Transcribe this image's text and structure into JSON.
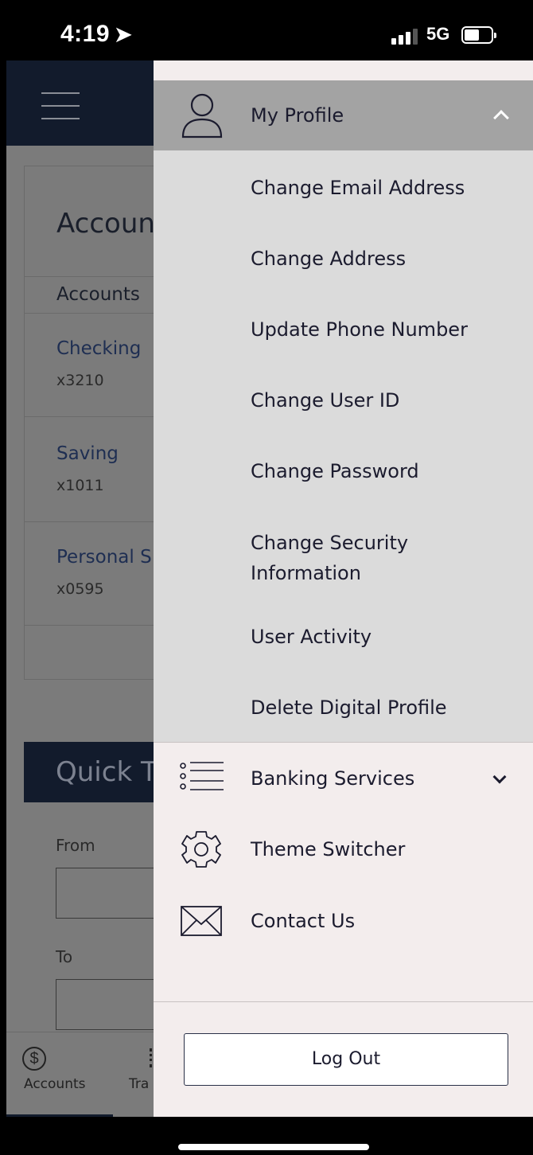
{
  "status_bar": {
    "time": "4:19",
    "network": "5G"
  },
  "background_app": {
    "accounts_title": "Accoun",
    "accounts_subheader": "Accounts",
    "accounts": [
      {
        "name": "Checking",
        "number": "x3210"
      },
      {
        "name": "Saving",
        "number": "x1011"
      },
      {
        "name": "Personal S",
        "number": "x0595"
      }
    ],
    "quick_title": "Quick T",
    "from_label": "From",
    "to_label": "To",
    "bottom_nav": {
      "accounts_icon": "$",
      "accounts_label": "Accounts",
      "transfer_label": "Tra"
    }
  },
  "drawer": {
    "profile": {
      "label": "My Profile",
      "expanded": true,
      "icon": "user-icon"
    },
    "profile_items": [
      "Change Email Address",
      "Change Address",
      "Update Phone Number",
      "Change User ID",
      "Change Password",
      "Change Security Information",
      "User Activity",
      "Delete Digital Profile"
    ],
    "menu": [
      {
        "label": "Banking Services",
        "icon": "list-icon",
        "expandable": true
      },
      {
        "label": "Theme Switcher",
        "icon": "gear-icon",
        "expandable": false
      },
      {
        "label": "Contact Us",
        "icon": "envelope-icon",
        "expandable": false
      }
    ],
    "logout_label": "Log Out"
  },
  "colors": {
    "header_navy": "#121b2c",
    "drawer_bg": "#f3eded",
    "submenu_bg": "#dbdbdb",
    "profile_header_bg": "#a3a3a3",
    "overlay_gray": "#7b7b7b"
  }
}
